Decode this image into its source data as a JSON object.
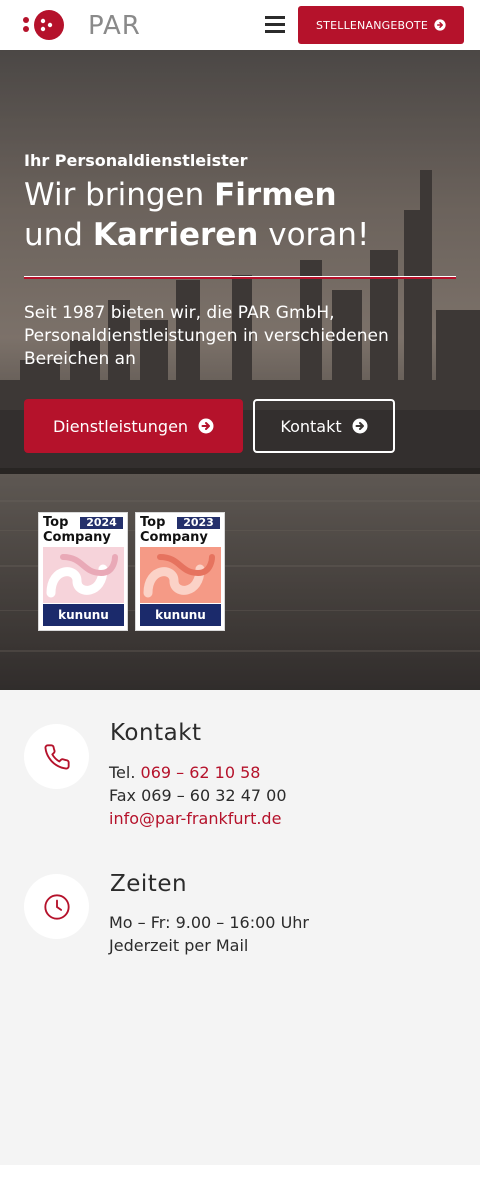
{
  "header": {
    "logo_text": "PAR",
    "jobs_button": "STELLENANGEBOTE",
    "icons": {
      "menu": "hamburger-icon",
      "jobs_arrow": "circle-arrow-right-icon"
    }
  },
  "hero": {
    "eyebrow": "Ihr Personaldienstleister",
    "headline_line1_prefix": "Wir bringen ",
    "headline_line1_bold": "Firmen",
    "headline_line2_prefix": "und ",
    "headline_line2_bold": "Karrieren",
    "headline_line2_suffix": " voran!",
    "subtitle": "Seit 1987 bieten wir, die PAR GmbH, Personaldienstleistungen in verschiedenen Bereichen an",
    "primary_button": "Dienstleistungen",
    "secondary_button": "Kontakt",
    "badges": [
      {
        "top": "Top",
        "year": "2024",
        "company": "Company",
        "brand": "kununu"
      },
      {
        "top": "Top",
        "year": "2023",
        "company": "Company",
        "brand": "kununu"
      }
    ]
  },
  "contact": {
    "title": "Kontakt",
    "tel_label": "Tel. ",
    "tel_value": "069 – 62 10 58",
    "fax": "Fax 069 – 60 32 47 00",
    "email": "info@par-frankfurt.de",
    "icon": "phone-icon"
  },
  "hours": {
    "title": "Zeiten",
    "line1": "Mo – Fr: 9.00 – 16:00 Uhr",
    "line2": "Jederzeit per Mail",
    "icon": "clock-icon"
  },
  "colors": {
    "brand_red": "#b5122b",
    "badge_navy": "#1b2a6b",
    "section_bg": "#f4f4f4"
  }
}
